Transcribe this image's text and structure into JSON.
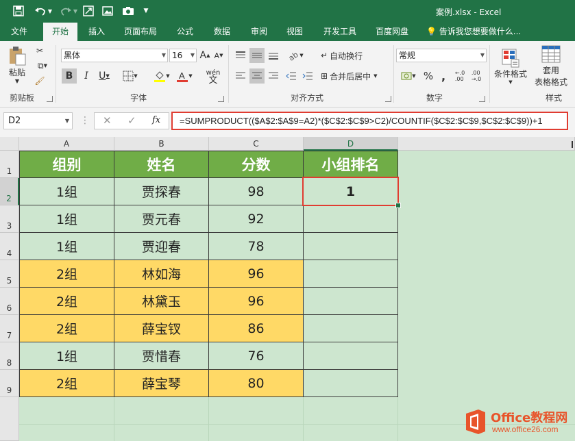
{
  "titlebar": {
    "title": "案例.xlsx - Excel",
    "icons": [
      "save-icon",
      "undo-icon",
      "redo-icon",
      "form-icon",
      "picture-icon",
      "camera-icon",
      "customize-icon"
    ]
  },
  "tabs": [
    "文件",
    "开始",
    "插入",
    "页面布局",
    "公式",
    "数据",
    "审阅",
    "视图",
    "开发工具",
    "百度网盘"
  ],
  "active_tab": "开始",
  "tell_me": "告诉我您想要做什么...",
  "ribbon": {
    "clipboard": {
      "paste": "粘贴",
      "label": "剪贴板"
    },
    "font": {
      "name": "黑体",
      "size": "16",
      "grow": "A",
      "shrink": "A",
      "bold": "B",
      "italic": "I",
      "underline": "U",
      "phonetic": "wén",
      "label": "字体"
    },
    "alignment": {
      "wrap": "自动换行",
      "merge": "合并后居中",
      "label": "对齐方式"
    },
    "number": {
      "format": "常规",
      "percent": "%",
      "comma": ",",
      "label": "数字"
    },
    "styles": {
      "conditional": "条件格式",
      "table1": "套用",
      "table2": "表格格式",
      "label": "样式"
    }
  },
  "formula_bar": {
    "name_box": "D2",
    "fx": "fx",
    "formula": "=SUMPRODUCT(($A$2:$A$9=A2)*($C$2:$C$9>C2)/COUNTIF($C$2:$C$9,$C$2:$C$9))+1"
  },
  "columns": [
    "A",
    "B",
    "C",
    "D"
  ],
  "rows": [
    "1",
    "2",
    "3",
    "4",
    "5",
    "6",
    "7",
    "8",
    "9"
  ],
  "table": {
    "headers": [
      "组别",
      "姓名",
      "分数",
      "小组排名"
    ],
    "rows": [
      [
        "1组",
        "贾探春",
        "98",
        "1"
      ],
      [
        "1组",
        "贾元春",
        "92",
        ""
      ],
      [
        "1组",
        "贾迎春",
        "78",
        ""
      ],
      [
        "2组",
        "林如海",
        "96",
        ""
      ],
      [
        "2组",
        "林黛玉",
        "96",
        ""
      ],
      [
        "2组",
        "薛宝钗",
        "86",
        ""
      ],
      [
        "1组",
        "贾惜春",
        "76",
        ""
      ],
      [
        "2组",
        "薛宝琴",
        "80",
        ""
      ]
    ]
  },
  "colors": {
    "excel_green": "#217346",
    "header_fill": "#70ad47",
    "group1_fill": "#cde6cf",
    "group2_fill": "#ffd966",
    "highlight": "#e03c31"
  },
  "watermark": {
    "brand": "Office教程网",
    "url": "www.office26.com"
  }
}
